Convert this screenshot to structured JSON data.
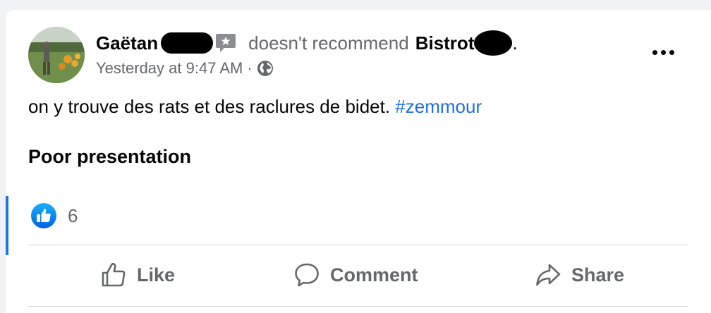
{
  "post": {
    "author": "Gaëtan",
    "verb": "doesn't recommend",
    "place": "Bistrot",
    "place_suffix": ".",
    "timestamp": "Yesterday at 9:47 AM",
    "separator": "·",
    "audience_icon": "globe-icon",
    "body_text": "on y trouve des rats et des raclures de bidet.",
    "hashtag": "#zemmour",
    "review_tag": "Poor presentation"
  },
  "reactions": {
    "icon": "like-reaction-icon",
    "count": "6"
  },
  "actions": {
    "like_label": "Like",
    "comment_label": "Comment",
    "share_label": "Share"
  },
  "colors": {
    "brand_blue": "#2374e1",
    "hashtag": "#216fdb",
    "secondary_text": "#65676b",
    "primary_text": "#050505"
  }
}
